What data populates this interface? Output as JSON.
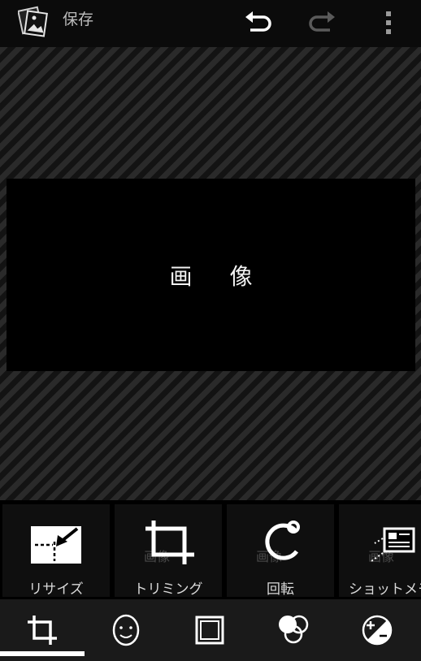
{
  "action_bar": {
    "save_label": "保存",
    "icons": {
      "app": "gallery-picture-icon",
      "undo": "undo-icon",
      "redo": "redo-icon",
      "overflow": "overflow-menu-icon"
    }
  },
  "canvas": {
    "image_text": "画像"
  },
  "tools": [
    {
      "label": "リサイズ",
      "icon": "resize-icon"
    },
    {
      "label": "トリミング",
      "icon": "crop-icon"
    },
    {
      "label": "回転",
      "icon": "rotate-icon"
    },
    {
      "label": "ショットメモ",
      "icon": "shot-memo-icon"
    }
  ],
  "tool_icon_faint_text": "画像",
  "tabs": [
    {
      "icon": "crop-tab-icon",
      "selected": true
    },
    {
      "icon": "face-icon",
      "selected": false
    },
    {
      "icon": "frame-icon",
      "selected": false
    },
    {
      "icon": "color-filter-icon",
      "selected": false
    },
    {
      "icon": "exposure-icon",
      "selected": false
    }
  ],
  "colors": {
    "background": "#000000",
    "action_bar": "#0b0b0b",
    "tab_bar": "#1a1a1a",
    "selected_indicator": "#ffffff",
    "disabled_icon": "#5a5a5a"
  }
}
